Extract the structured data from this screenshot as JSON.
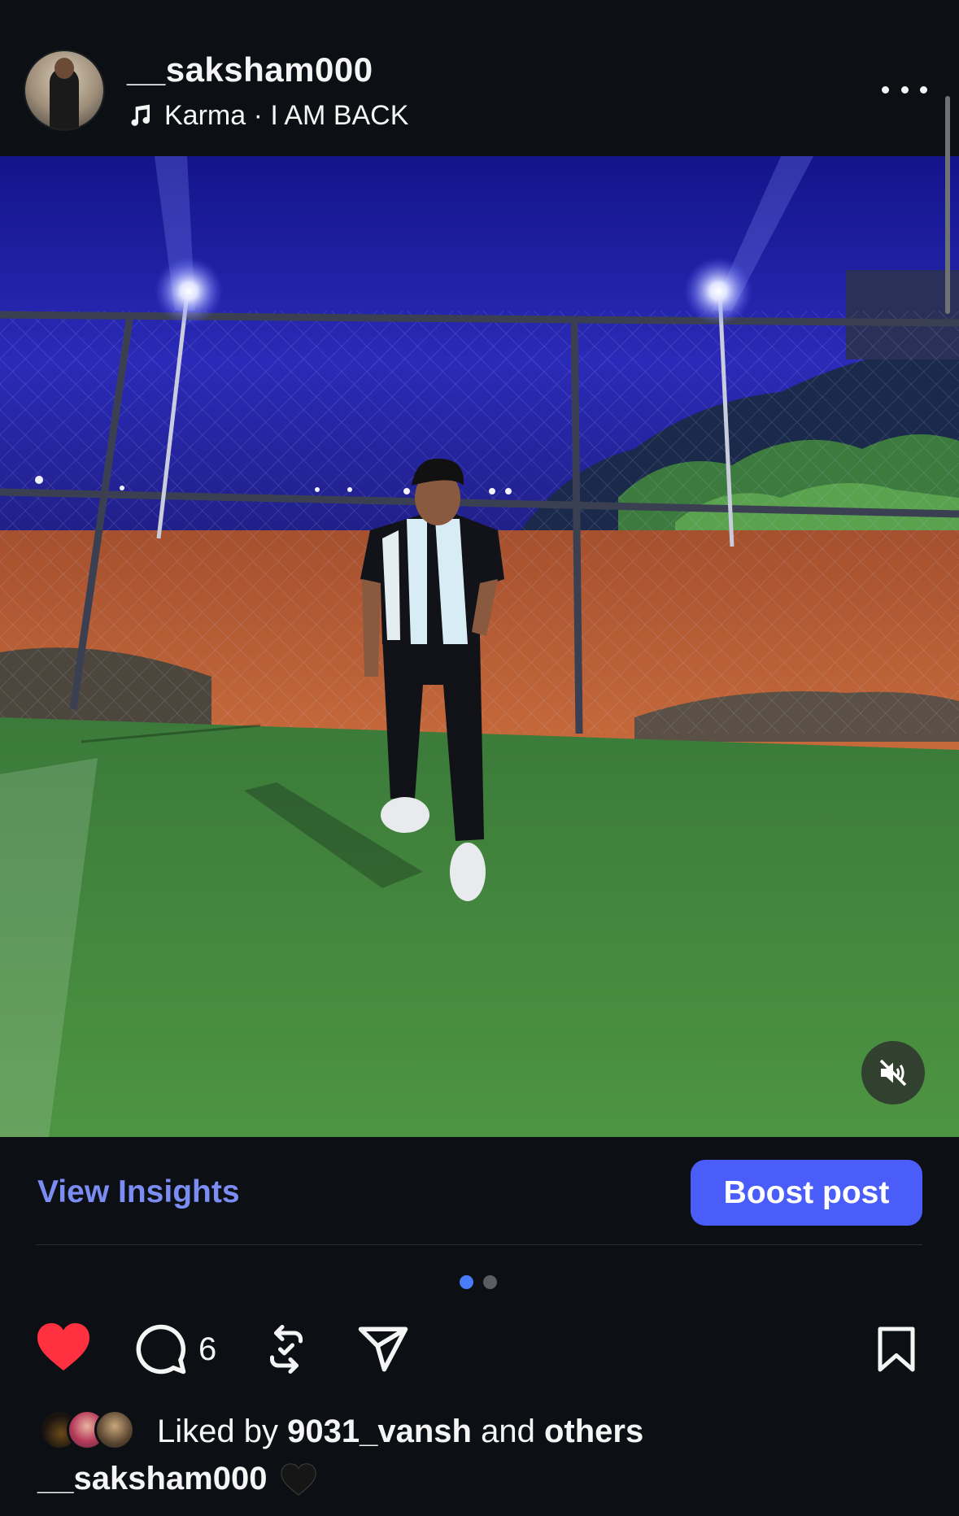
{
  "post": {
    "username": "__saksham000",
    "audio": "Karma · I AM BACK"
  },
  "insights": {
    "view_label": "View Insights",
    "boost_label": "Boost post"
  },
  "carousel": {
    "current": 1,
    "total": 2
  },
  "actions": {
    "liked": true,
    "comment_count": "6"
  },
  "likes": {
    "prefix": "Liked by",
    "user": "9031_vansh",
    "connector": "and",
    "suffix": "others"
  },
  "caption": {
    "username": "__saksham000",
    "emoji": "🖤"
  },
  "icons": {
    "more": "more-options-icon",
    "music": "music-note-icon",
    "mute": "muted-speaker-icon",
    "heart": "heart-icon",
    "comment": "comment-icon",
    "repost": "repost-icon",
    "share": "share-icon",
    "save": "bookmark-icon"
  },
  "colors": {
    "background": "#0c1014",
    "accent": "#4a5df9",
    "link": "#7b8cf3",
    "heart": "#ff3040"
  }
}
